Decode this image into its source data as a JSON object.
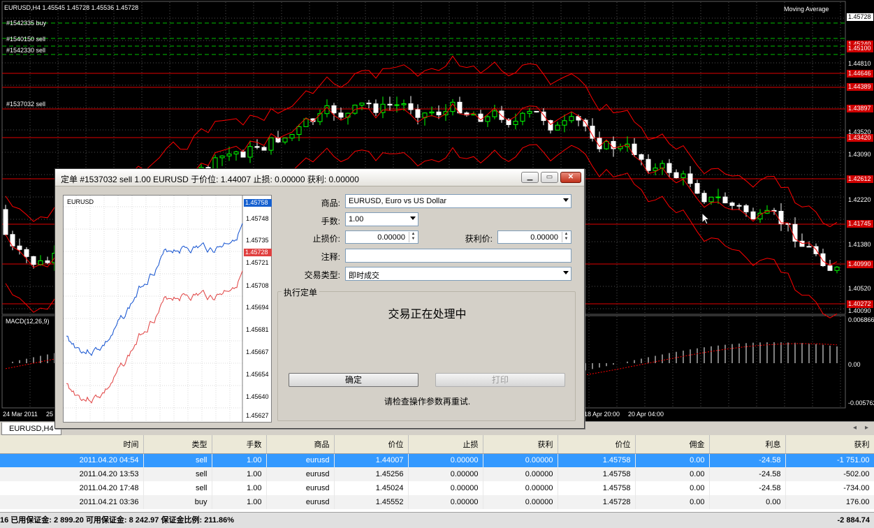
{
  "chart": {
    "header": "EURUSD,H4  1.45545 1.45728 1.45536 1.45728",
    "indicator": "Moving Average",
    "macd_label": "MACD(12,26,9)",
    "macd_ticks": [
      "0.006866",
      "0.00",
      "-0.005762"
    ],
    "orders": [
      "#1542335 buy",
      "#1540150 sell",
      "#1542330 sell",
      "#1537032 sell"
    ],
    "price_ticks": [
      "1.44810",
      "1.43520",
      "1.43090",
      "1.42220",
      "1.41380",
      "1.40520",
      "1.40090"
    ],
    "price_tags": [
      {
        "label": "1.45728",
        "style": "white"
      },
      {
        "label": "1.45240",
        "style": "red"
      },
      {
        "label": "1.45100",
        "style": "red"
      },
      {
        "label": "1.44646",
        "style": "red"
      },
      {
        "label": "1.44389",
        "style": "red"
      },
      {
        "label": "1.43897",
        "style": "red"
      },
      {
        "label": "1.43420",
        "style": "red"
      },
      {
        "label": "1.42612",
        "style": "red"
      },
      {
        "label": "1.41745",
        "style": "red"
      },
      {
        "label": "1.40990",
        "style": "red"
      },
      {
        "label": "1.40272",
        "style": "red"
      }
    ],
    "time_labels": [
      "24 Mar 2011",
      "25",
      "18 Apr 20:00",
      "20 Apr 04:00"
    ]
  },
  "tabs": {
    "active": "EURUSD,H4"
  },
  "dialog": {
    "title": "定单 #1537032 sell 1.00 EURUSD 于价位: 1.44007 止损: 0.00000 获利: 0.00000",
    "mini_chart": {
      "symbol": "EURUSD",
      "ticks": [
        "1.45748",
        "1.45735",
        "1.45721",
        "1.45708",
        "1.45694",
        "1.45681",
        "1.45667",
        "1.45654",
        "1.45640",
        "1.45627"
      ],
      "ask_tag": "1.45758",
      "bid_tag": "1.45728"
    },
    "symbol_label": "商品:",
    "symbol_value": "EURUSD, Euro vs US Dollar",
    "volume_label": "手数:",
    "volume_value": "1.00",
    "sl_label": "止损价:",
    "sl_value": "0.00000",
    "tp_label": "获利价:",
    "tp_value": "0.00000",
    "comment_label": "注释:",
    "comment_value": "",
    "type_label": "交易类型:",
    "type_value": "即时成交",
    "group_legend": "执行定单",
    "processing": "交易正在处理中",
    "ok_button": "确定",
    "print_button": "打印",
    "hint": "请检查操作参数再重试."
  },
  "terminal": {
    "columns": [
      "时间",
      "类型",
      "手数",
      "商品",
      "价位",
      "止损",
      "获利",
      "价位",
      "佣金",
      "利息",
      "获利"
    ],
    "rows": [
      [
        "2011.04.20 04:54",
        "sell",
        "1.00",
        "eurusd",
        "1.44007",
        "0.00000",
        "0.00000",
        "1.45758",
        "0.00",
        "-24.58",
        "-1 751.00"
      ],
      [
        "2011.04.20 13:53",
        "sell",
        "1.00",
        "eurusd",
        "1.45256",
        "0.00000",
        "0.00000",
        "1.45758",
        "0.00",
        "-24.58",
        "-502.00"
      ],
      [
        "2011.04.20 17:48",
        "sell",
        "1.00",
        "eurusd",
        "1.45024",
        "0.00000",
        "0.00000",
        "1.45758",
        "0.00",
        "-24.58",
        "-734.00"
      ],
      [
        "2011.04.21 03:36",
        "buy",
        "1.00",
        "eurusd",
        "1.45552",
        "0.00000",
        "0.00000",
        "1.45728",
        "0.00",
        "0.00",
        "176.00"
      ]
    ],
    "status_left": "16  已用保证金: 2 899.20  可用保证金: 8 242.97  保证金比例: 211.86%",
    "status_right": "-2 884.74"
  },
  "colors": {
    "bull": "#00ff00",
    "bear": "#ff0000",
    "grid": "#2f3f2f",
    "selected_row": "#3399ff"
  }
}
